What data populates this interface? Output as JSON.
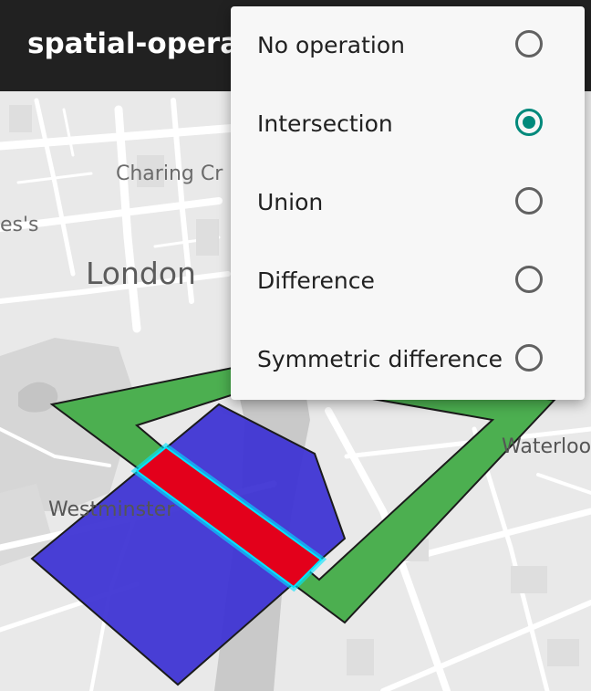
{
  "app": {
    "title": "spatial-operations"
  },
  "map": {
    "labels": {
      "charing_cross": "Charing Cr",
      "james": "es's",
      "london": "London",
      "westminster": "Westminster",
      "waterloo": "Waterloo"
    },
    "colors": {
      "polygon_one": "#4caf50",
      "polygon_two": "#3f35d4",
      "result": "#e3001b",
      "result_glow": "#00e5ff"
    }
  },
  "menu": {
    "selected_index": 1,
    "accent_color": "#00897b",
    "items": [
      {
        "label": "No operation",
        "checked": false
      },
      {
        "label": "Intersection",
        "checked": true
      },
      {
        "label": "Union",
        "checked": false
      },
      {
        "label": "Difference",
        "checked": false
      },
      {
        "label": "Symmetric difference",
        "checked": false
      }
    ]
  }
}
